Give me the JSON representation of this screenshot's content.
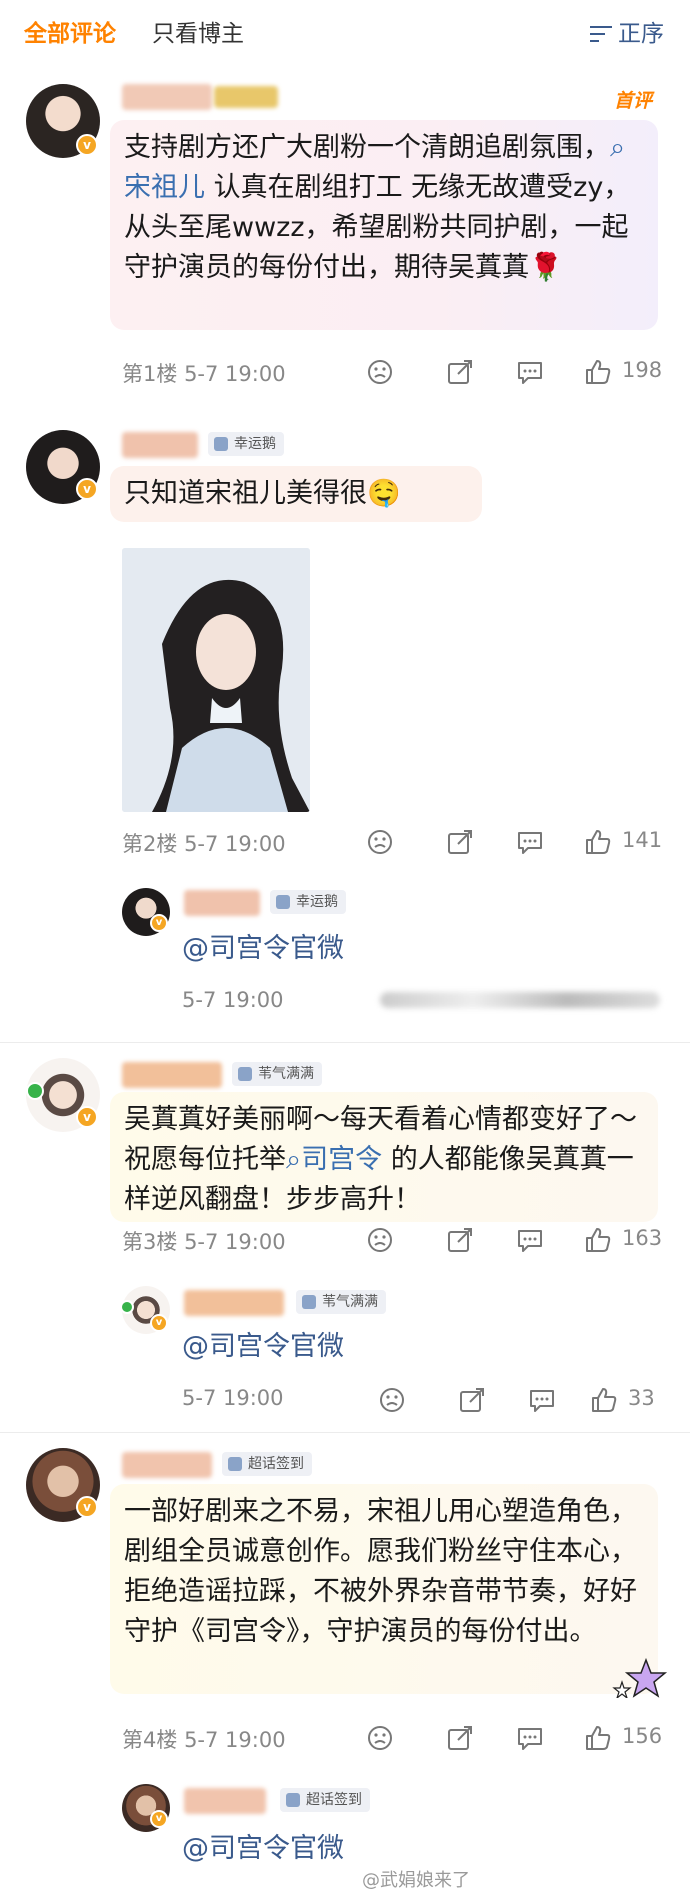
{
  "tabs": {
    "all": "全部评论",
    "author_only": "只看博主"
  },
  "sort": {
    "label": "正序",
    "icon": "sort-icon"
  },
  "first_comment_badge": "首评",
  "comments": [
    {
      "tag": "",
      "text_a": "支持剧方还广大剧粉一个清朗追剧氛围，",
      "topic": "宋祖儿",
      "text_b": " 认真在剧组打工 无缘无故遭受zy，从头至尾wwzz，希望剧粉共同护剧，一起守护演员的每份付出，期待吴蒖蒖",
      "emoji": "🌹",
      "floor": "第1楼",
      "time": "5-7 19:00",
      "likes": "198"
    },
    {
      "tag": "幸运鹅",
      "text": "只知道宋祖儿美得很",
      "emoji": "🤤",
      "floor": "第2楼",
      "time": "5-7 19:00",
      "likes": "141",
      "reply": {
        "tag": "幸运鹅",
        "text": "@司宫令官微",
        "time": "5-7 19:00"
      }
    },
    {
      "tag": "苇气满满",
      "text_a": "吴蒖蒖好美丽啊～每天看着心情都变好了～祝愿每位托举",
      "topic": "司宫令",
      "text_b": " 的人都能像吴蒖蒖一样逆风翻盘！步步高升！",
      "floor": "第3楼",
      "time": "5-7 19:00",
      "likes": "163",
      "reply": {
        "tag": "苇气满满",
        "text": "@司宫令官微",
        "time": "5-7 19:00",
        "likes": "33"
      }
    },
    {
      "tag": "超话签到",
      "text": "一部好剧来之不易，宋祖儿用心塑造角色，剧组全员诚意创作。愿我们粉丝守住本心，拒绝造谣拉踩，不被外界杂音带节奏，好好守护《司宫令》，守护演员的每份付出。",
      "floor": "第4楼",
      "time": "5-7 19:00",
      "likes": "156",
      "reply": {
        "tag": "超话签到",
        "text": "@司宫令官微"
      }
    }
  ],
  "watermark": "@武娟娘来了",
  "colors": {
    "accent": "#ff8200",
    "link": "#3a6fb0",
    "mention": "#3a5a8c",
    "meta": "#888888"
  }
}
